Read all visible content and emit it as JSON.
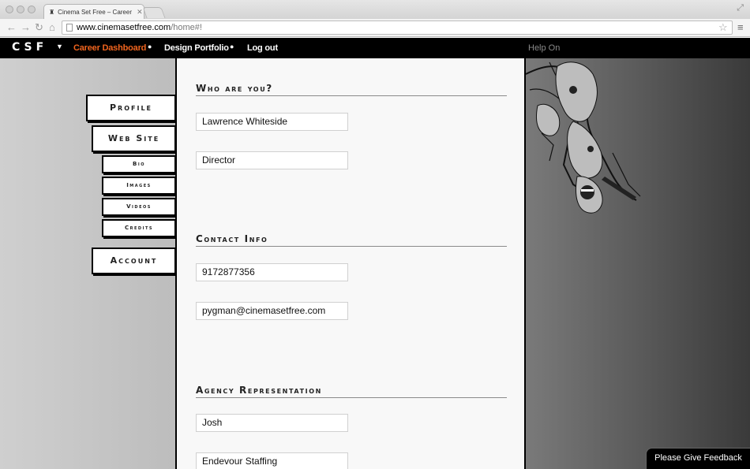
{
  "browser": {
    "tab_title": "Cinema Set Free – Career D",
    "url_domain": "www.cinemasetfree.com",
    "url_path": "/home#!"
  },
  "nav": {
    "logo": "CSF",
    "links": [
      "Career Dashboard",
      "Design Portfolio",
      "Log out"
    ],
    "help": "Help On",
    "active_color": "#f0641e"
  },
  "sidebar": {
    "profile": "Profile",
    "website": "Web Site",
    "sub_items": [
      "Bio",
      "Images",
      "Videos",
      "Credits"
    ],
    "account": "Account"
  },
  "sections": [
    {
      "heading": "Who are you?",
      "fields": [
        "Lawrence Whiteside",
        "Director"
      ]
    },
    {
      "heading": "Contact Info",
      "fields": [
        "9172877356",
        "pygman@cinemasetfree.com"
      ]
    },
    {
      "heading": "Agency Representation",
      "fields": [
        "Josh",
        "Endevour Staffing"
      ]
    }
  ],
  "feedback": "Please Give Feedback"
}
